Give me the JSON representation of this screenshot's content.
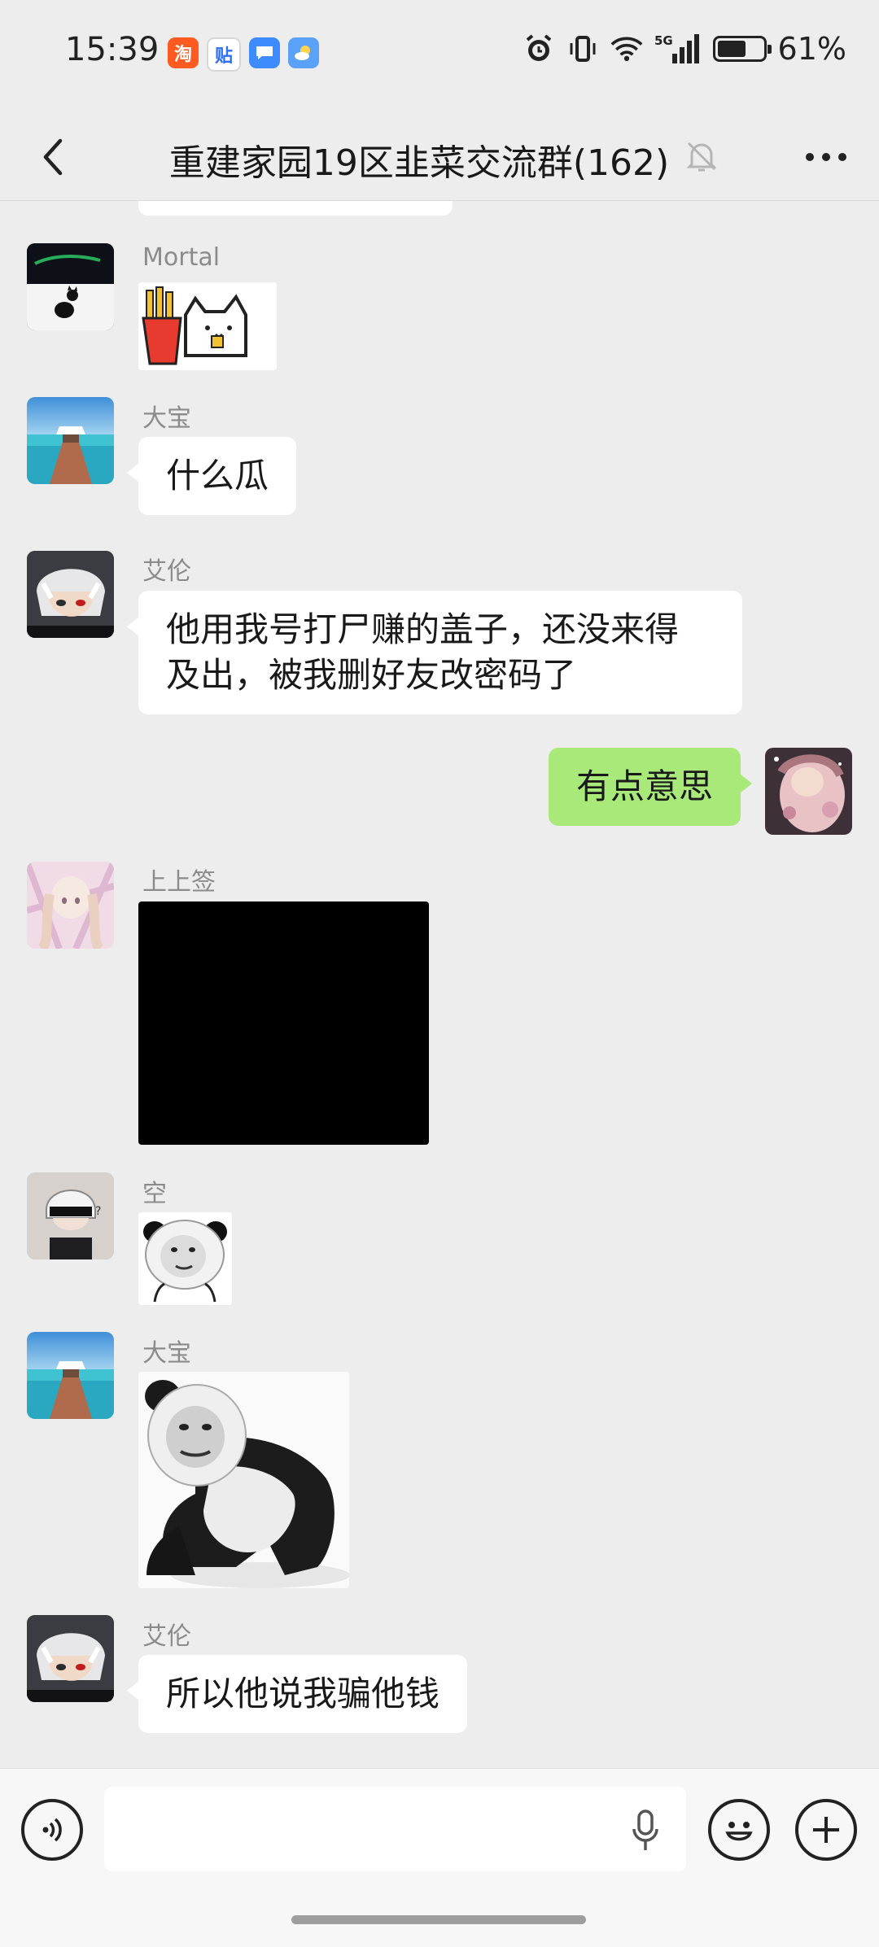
{
  "status_bar": {
    "time": "15:39",
    "app_icons": [
      "taobao-icon",
      "tieba-icon",
      "messages-icon",
      "weather-icon"
    ],
    "network": "5G",
    "battery": "61%",
    "battery_level": 0.61
  },
  "header": {
    "title": "重建家园19区韭菜交流群(162)",
    "back_icon": "chevron-left-icon",
    "mute_icon": "bell-muted-icon",
    "more_icon": "more-dots-icon"
  },
  "messages": [
    {
      "sender": "Mortal",
      "type": "sticker",
      "content": "fries-cat-sticker"
    },
    {
      "sender": "大宝",
      "type": "text",
      "text": "什么瓜"
    },
    {
      "sender": "艾伦",
      "type": "text",
      "text": "他用我号打尸赚的盖子，还没来得\n及出，被我删好友改密码了"
    },
    {
      "sender": "me",
      "type": "text",
      "text": "有点意思"
    },
    {
      "sender": "上上签",
      "type": "image",
      "content": "black-image"
    },
    {
      "sender": "空",
      "type": "sticker",
      "content": "panda-face-sticker"
    },
    {
      "sender": "大宝",
      "type": "sticker",
      "content": "panda-meme-sticker"
    },
    {
      "sender": "艾伦",
      "type": "text",
      "text": "所以他说我骗他钱"
    }
  ],
  "input_bar": {
    "text_value": "",
    "voice_icon": "voice-mode-icon",
    "mic_icon": "microphone-icon",
    "emoji_icon": "emoji-icon",
    "plus_icon": "plus-icon"
  },
  "colors": {
    "background": "#ededed",
    "own_bubble": "#a9e97a",
    "other_bubble": "#ffffff",
    "sender_name": "#8b8b8b"
  }
}
